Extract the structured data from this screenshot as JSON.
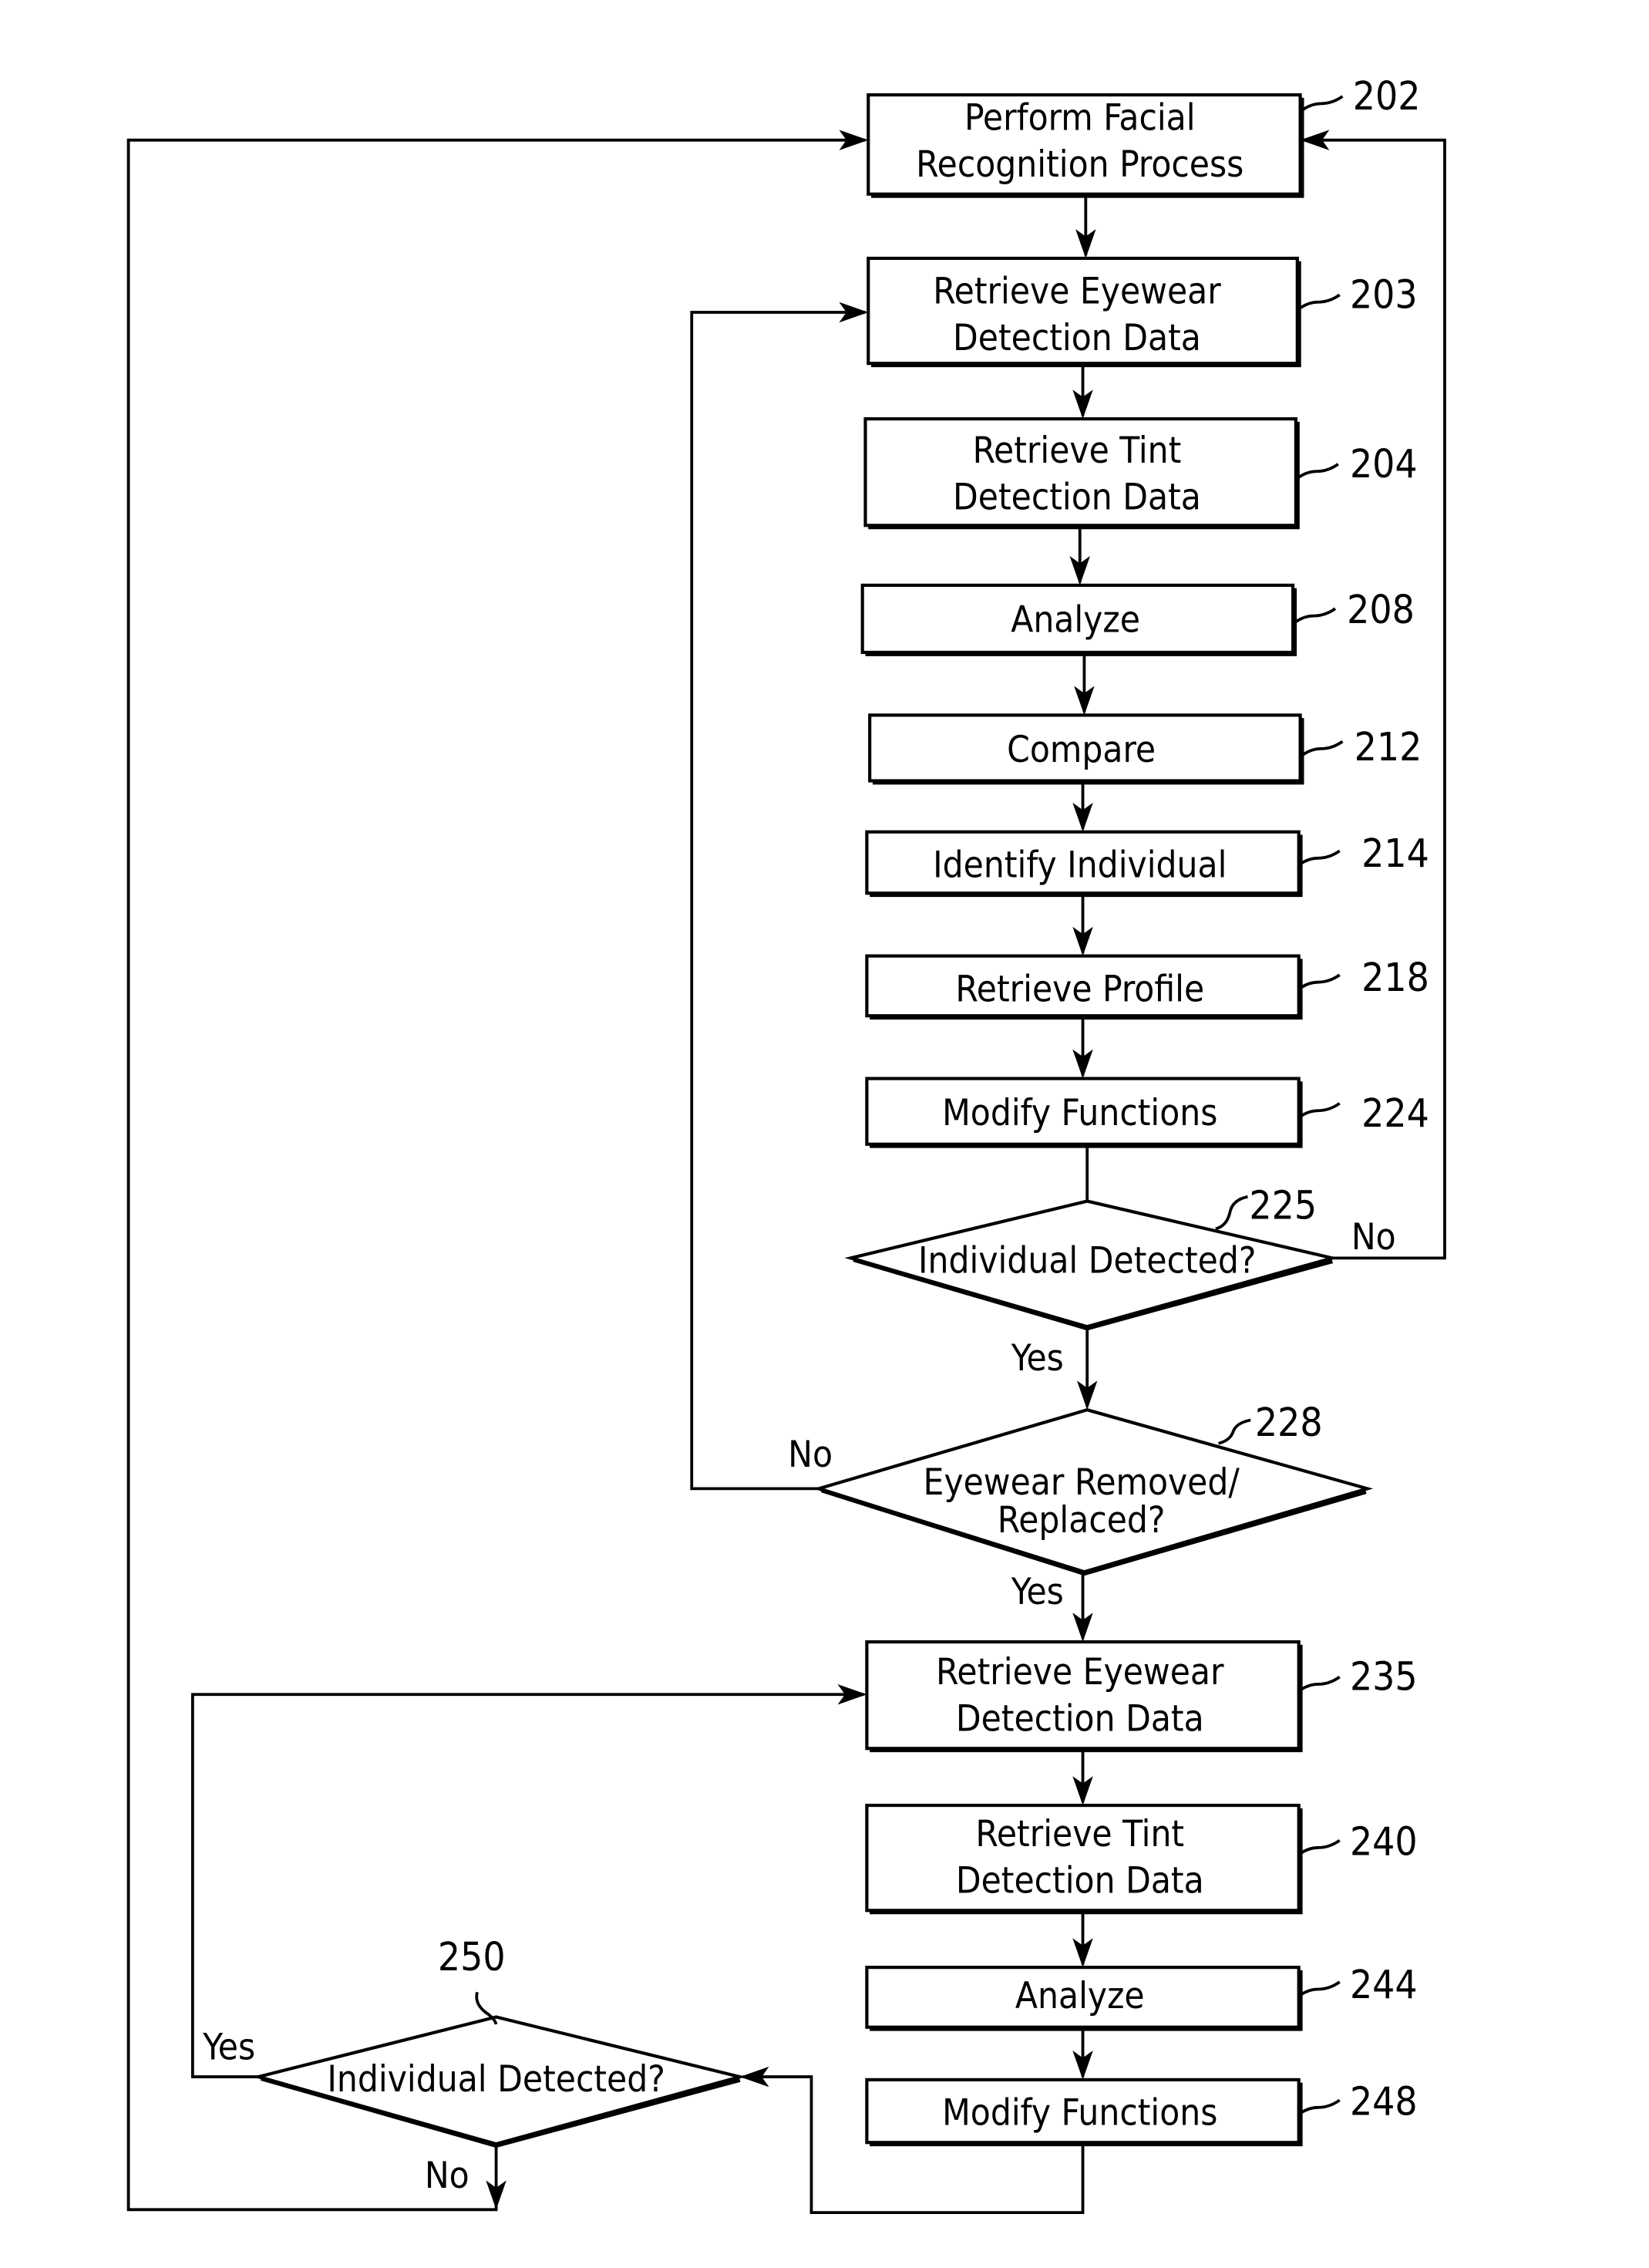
{
  "figure": {
    "type": "flowchart",
    "colors": {
      "stroke": "#000000",
      "background": "#ffffff"
    }
  },
  "nodes": {
    "n202": {
      "ref": "202",
      "lines": [
        "Perform Facial",
        "Recognition Process"
      ],
      "shape": "process"
    },
    "n203": {
      "ref": "203",
      "lines": [
        "Retrieve Eyewear",
        "Detection Data"
      ],
      "shape": "process"
    },
    "n204": {
      "ref": "204",
      "lines": [
        "Retrieve Tint",
        "Detection Data"
      ],
      "shape": "process"
    },
    "n208": {
      "ref": "208",
      "lines": [
        "Analyze"
      ],
      "shape": "process"
    },
    "n212": {
      "ref": "212",
      "lines": [
        "Compare"
      ],
      "shape": "process"
    },
    "n214": {
      "ref": "214",
      "lines": [
        "Identify Individual"
      ],
      "shape": "process"
    },
    "n218": {
      "ref": "218",
      "lines": [
        "Retrieve Profile"
      ],
      "shape": "process"
    },
    "n224": {
      "ref": "224",
      "lines": [
        "Modify Functions"
      ],
      "shape": "process"
    },
    "n225": {
      "ref": "225",
      "lines": [
        "Individual Detected?"
      ],
      "shape": "decision"
    },
    "n228": {
      "ref": "228",
      "lines": [
        "Eyewear Removed/",
        "Replaced?"
      ],
      "shape": "decision"
    },
    "n235": {
      "ref": "235",
      "lines": [
        "Retrieve Eyewear",
        "Detection Data"
      ],
      "shape": "process"
    },
    "n240": {
      "ref": "240",
      "lines": [
        "Retrieve Tint",
        "Detection Data"
      ],
      "shape": "process"
    },
    "n244": {
      "ref": "244",
      "lines": [
        "Analyze"
      ],
      "shape": "process"
    },
    "n248": {
      "ref": "248",
      "lines": [
        "Modify Functions"
      ],
      "shape": "process"
    },
    "n250": {
      "ref": "250",
      "lines": [
        "Individual Detected?"
      ],
      "shape": "decision"
    }
  },
  "edge_labels": {
    "e225_no": "No",
    "e225_yes": "Yes",
    "e228_no": "No",
    "e228_yes": "Yes",
    "e250_yes": "Yes",
    "e250_no": "No"
  },
  "edges": [
    {
      "from": "202",
      "to": "203"
    },
    {
      "from": "203",
      "to": "204"
    },
    {
      "from": "204",
      "to": "208"
    },
    {
      "from": "208",
      "to": "212"
    },
    {
      "from": "212",
      "to": "214"
    },
    {
      "from": "214",
      "to": "218"
    },
    {
      "from": "218",
      "to": "224"
    },
    {
      "from": "224",
      "to": "225"
    },
    {
      "from": "225",
      "to": "202",
      "label": "No"
    },
    {
      "from": "225",
      "to": "228",
      "label": "Yes"
    },
    {
      "from": "228",
      "to": "203",
      "label": "No"
    },
    {
      "from": "228",
      "to": "235",
      "label": "Yes"
    },
    {
      "from": "235",
      "to": "240"
    },
    {
      "from": "240",
      "to": "244"
    },
    {
      "from": "244",
      "to": "248"
    },
    {
      "from": "248",
      "to": "250"
    },
    {
      "from": "250",
      "to": "235",
      "label": "Yes"
    },
    {
      "from": "250",
      "to": "202",
      "label": "No"
    }
  ]
}
